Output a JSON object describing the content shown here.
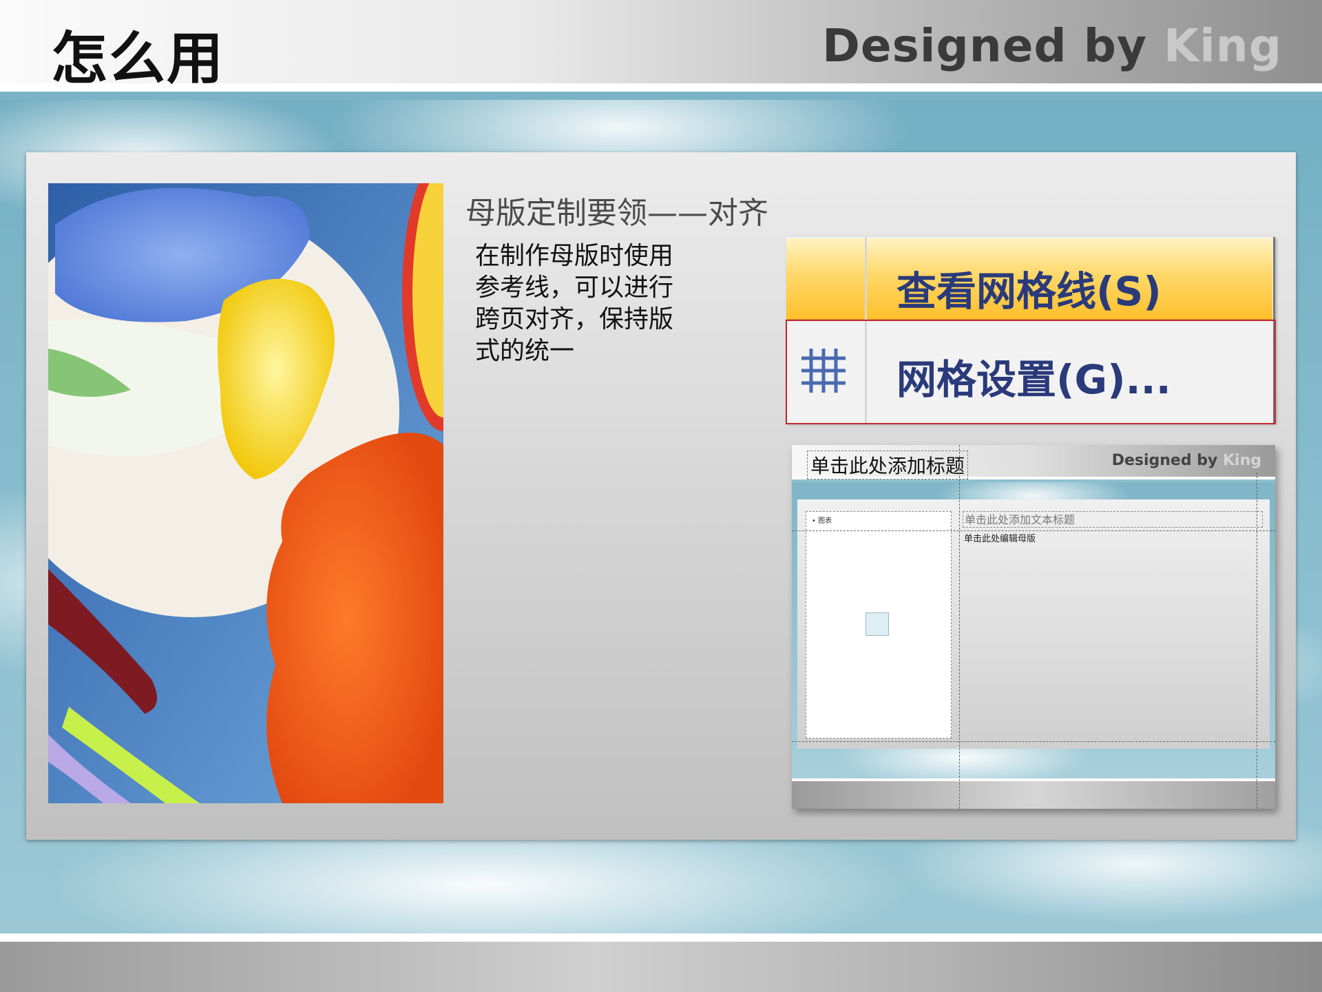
{
  "header": {
    "title": "怎么用",
    "brand_part1": "Designed by ",
    "brand_part2": "King"
  },
  "content": {
    "heading": "母版定制要领——对齐",
    "body": "在制作母版时使用参考线，可以进行跨页对齐，保持版式的统一"
  },
  "menu": {
    "items": [
      {
        "label": "查看网格线(S)",
        "icon": "none"
      },
      {
        "label": "网格设置(G)...",
        "icon": "grid-icon"
      }
    ],
    "highlight_color": "#c0282b"
  },
  "preview": {
    "title": "单击此处添加标题",
    "brand_part1": "Designed by ",
    "brand_part2": "King",
    "subtitle_placeholder": "单击此处添加文本标题",
    "body_placeholder": "单击此处编辑母版",
    "bullet": "• 图表"
  },
  "colors": {
    "menu_highlight": "#ffc02c",
    "menu_text": "#2a3a7a",
    "brand_dark": "#3a3a3a",
    "brand_light": "#c9c9c9"
  }
}
